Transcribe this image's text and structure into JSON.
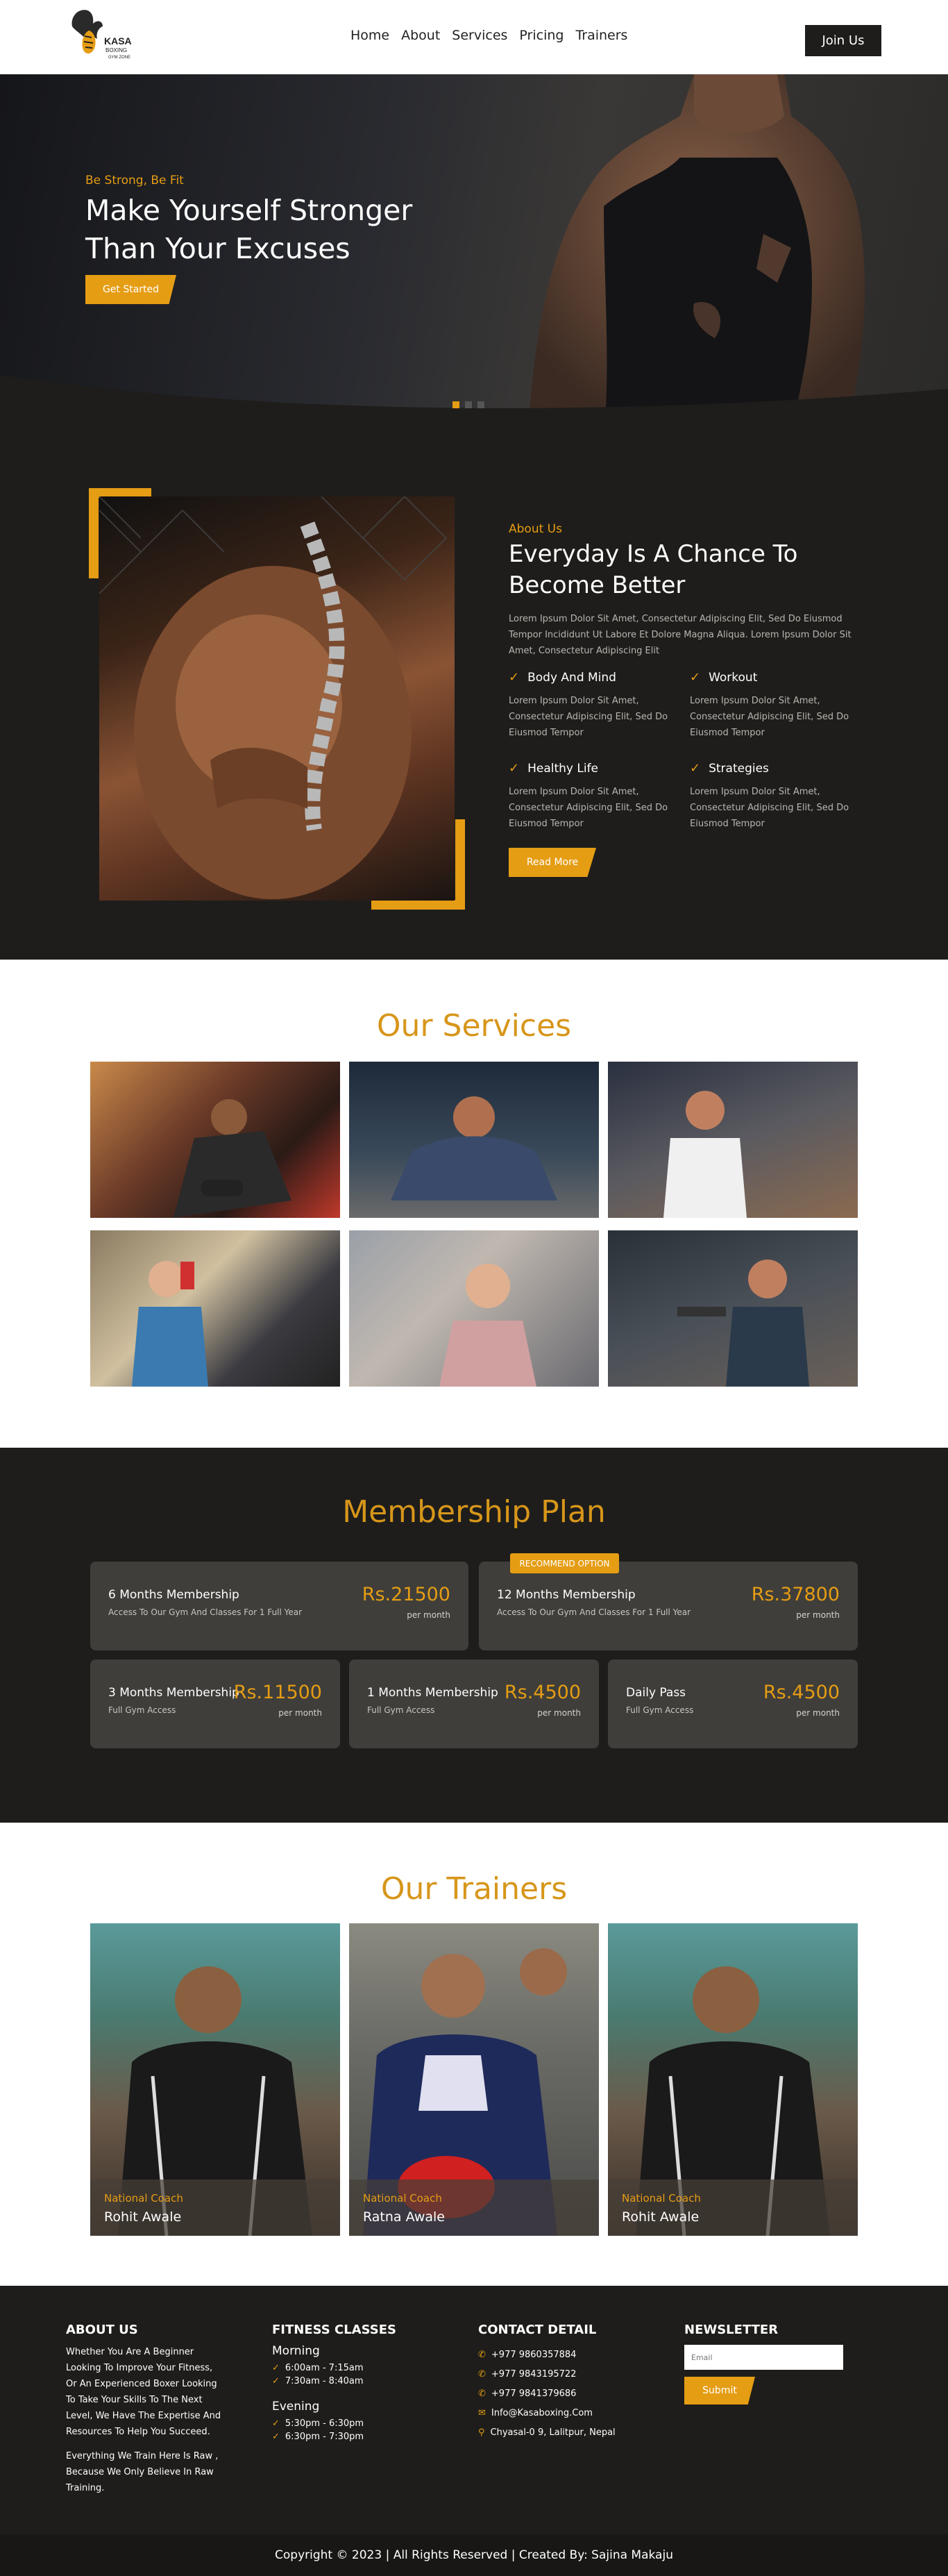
{
  "brand": {
    "name": "KASA",
    "sub": "BOXING",
    "tagline": "GYM ZONE",
    "accent": "#e59d14",
    "dark": "#1e1d1b"
  },
  "nav": [
    "Home",
    "About",
    "Services",
    "Pricing",
    "Trainers"
  ],
  "header": {
    "join": "Join Us"
  },
  "hero": {
    "tag": "Be Strong, Be Fit",
    "title": "Make Yourself Stronger Than Your Excuses",
    "button": "Get Started"
  },
  "about": {
    "tag": "About Us",
    "title": "Everyday Is A Chance To Become Better",
    "text": "Lorem Ipsum Dolor Sit Amet, Consectetur Adipiscing Elit, Sed Do Eiusmod Tempor Incididunt Ut Labore Et Dolore Magna Aliqua. Lorem Ipsum Dolor Sit Amet, Consectetur Adipiscing Elit",
    "features": [
      {
        "title": "Body And Mind",
        "text": "Lorem Ipsum Dolor Sit Amet, Consectetur Adipiscing Elit, Sed Do Eiusmod Tempor"
      },
      {
        "title": "Workout",
        "text": "Lorem Ipsum Dolor Sit Amet, Consectetur Adipiscing Elit, Sed Do Eiusmod Tempor"
      },
      {
        "title": "Healthy Life",
        "text": "Lorem Ipsum Dolor Sit Amet, Consectetur Adipiscing Elit, Sed Do Eiusmod Tempor"
      },
      {
        "title": "Strategies",
        "text": "Lorem Ipsum Dolor Sit Amet, Consectetur Adipiscing Elit, Sed Do Eiusmod Tempor"
      }
    ],
    "button": "Read More"
  },
  "services": {
    "title": "Our Services"
  },
  "membership": {
    "title": "Membership Plan",
    "badge": "RECOMMEND OPTION",
    "plans": [
      {
        "name": "6 Months Membership",
        "desc": "Access To Our Gym And Classes For 1 Full Year",
        "price": "Rs.21500",
        "per": "per month"
      },
      {
        "name": "12 Months Membership",
        "desc": "Access To Our Gym And Classes For 1 Full Year",
        "price": "Rs.37800",
        "per": "per month"
      },
      {
        "name": "3 Months Membership",
        "desc": "Full Gym Access",
        "price": "Rs.11500",
        "per": "per month"
      },
      {
        "name": "1 Months Membership",
        "desc": "Full Gym Access",
        "price": "Rs.4500",
        "per": "per month"
      },
      {
        "name": "Daily Pass",
        "desc": "Full Gym Access",
        "price": "Rs.4500",
        "per": "per month"
      }
    ]
  },
  "trainers": {
    "title": "Our Trainers",
    "list": [
      {
        "role": "National Coach",
        "name": "Rohit Awale"
      },
      {
        "role": "National Coach",
        "name": "Ratna Awale"
      },
      {
        "role": "National Coach",
        "name": "Rohit Awale"
      }
    ]
  },
  "footer": {
    "about_title": "ABOUT US",
    "about_text1": "Whether You Are A Beginner Looking To Improve Your Fitness, Or An Experienced Boxer Looking To Take Your Skills To The Next Level, We Have The Expertise And Resources To Help You Succeed.",
    "about_text2": "Everything We Train Here Is Raw , Because We Only Believe In Raw Training.",
    "classes_title": "FITNESS CLASSES",
    "morning": "Morning",
    "morning_times": [
      "6:00am - 7:15am",
      "7:30am - 8:40am"
    ],
    "evening": "Evening",
    "evening_times": [
      "5:30pm - 6:30pm",
      "6:30pm - 7:30pm"
    ],
    "contact_title": "CONTACT DETAIL",
    "contacts": [
      "+977 9860357884",
      "+977 9843195722",
      "+977 9841379686",
      "Info@Kasaboxing.Com",
      "Chyasal-0 9, Lalitpur, Nepal"
    ],
    "news_title": "NEWSLETTER",
    "email_placeholder": "Email",
    "submit": "Submit",
    "copyright": "Copyright © 2023 | All Rights Reserved | Created By: Sajina Makaju"
  }
}
